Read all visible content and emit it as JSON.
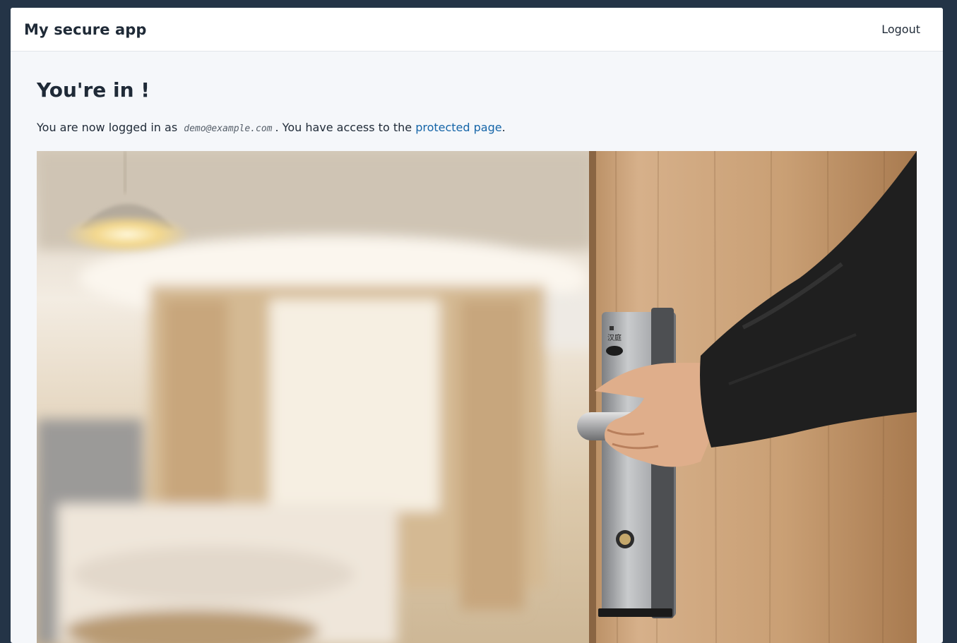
{
  "navbar": {
    "brand": "My secure app",
    "logout_label": "Logout"
  },
  "main": {
    "heading": "You're in !",
    "intro_prefix": "You are now logged in as",
    "user_email": "demo@example.com",
    "intro_middle": ". You have access to the",
    "protected_link_label": "protected page",
    "intro_suffix": "."
  },
  "hero_image": {
    "lock_label": "汉庭"
  }
}
